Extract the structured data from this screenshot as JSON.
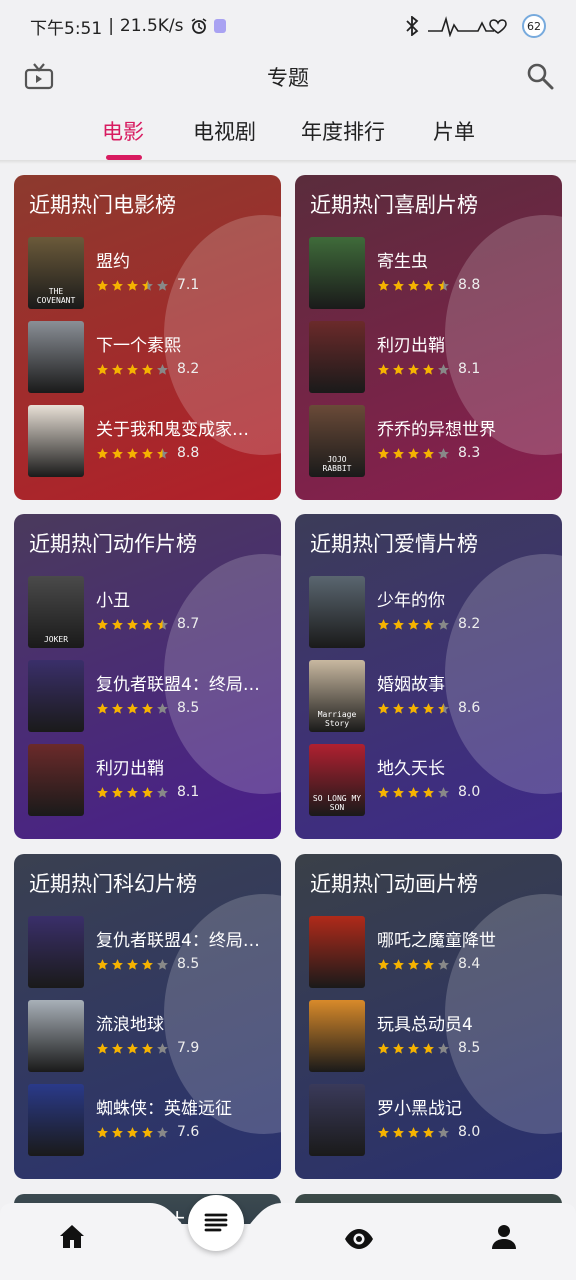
{
  "status_bar": {
    "time": "下午5:51",
    "network_speed": "21.5K/s",
    "battery": "62"
  },
  "header": {
    "title": "专题"
  },
  "tabs": [
    {
      "label": "电影",
      "active": true
    },
    {
      "label": "电视剧",
      "active": false
    },
    {
      "label": "年度排行",
      "active": false
    },
    {
      "label": "片单",
      "active": false
    }
  ],
  "cards": [
    {
      "title": "近期热门电影榜",
      "color_top": "#8c3a2e",
      "color_bottom": "#b2202a",
      "movies": [
        {
          "name": "盟约",
          "score": "7.1",
          "stars": 3.5,
          "poster_text": "THE COVENANT",
          "poster_color": "#6b5a3a"
        },
        {
          "name": "下一个素熙",
          "score": "8.2",
          "stars": 4,
          "poster_text": "",
          "poster_color": "#8a8f96"
        },
        {
          "name": "关于我和鬼变成家…",
          "score": "8.8",
          "stars": 4.5,
          "poster_text": "",
          "poster_color": "#e8e0d6"
        }
      ]
    },
    {
      "title": "近期热门喜剧片榜",
      "color_top": "#5a2c3c",
      "color_bottom": "#8a1f4f",
      "movies": [
        {
          "name": "寄生虫",
          "score": "8.8",
          "stars": 4.5,
          "poster_text": "",
          "poster_color": "#3f6b3a"
        },
        {
          "name": "利刃出鞘",
          "score": "8.1",
          "stars": 4,
          "poster_text": "",
          "poster_color": "#6b2a2a"
        },
        {
          "name": "乔乔的异想世界",
          "score": "8.3",
          "stars": 4,
          "poster_text": "JOJO RABBIT",
          "poster_color": "#6a4a38"
        }
      ]
    },
    {
      "title": "近期热门动作片榜",
      "color_top": "#4a3a5c",
      "color_bottom": "#4a1f8c",
      "movies": [
        {
          "name": "小丑",
          "score": "8.7",
          "stars": 4.5,
          "poster_text": "JOKER",
          "poster_color": "#4a4a4a"
        },
        {
          "name": "复仇者联盟4：终局…",
          "score": "8.5",
          "stars": 4,
          "poster_text": "",
          "poster_color": "#3a2f6a"
        },
        {
          "name": "利刃出鞘",
          "score": "8.1",
          "stars": 4,
          "poster_text": "",
          "poster_color": "#6b2a2a"
        }
      ]
    },
    {
      "title": "近期热门爱情片榜",
      "color_top": "#3c3c58",
      "color_bottom": "#3f2a8a",
      "movies": [
        {
          "name": "少年的你",
          "score": "8.2",
          "stars": 4,
          "poster_text": "",
          "poster_color": "#5a6670"
        },
        {
          "name": "婚姻故事",
          "score": "8.6",
          "stars": 4.5,
          "poster_text": "Marriage Story",
          "poster_color": "#c8b8a0"
        },
        {
          "name": "地久天长",
          "score": "8.0",
          "stars": 4,
          "poster_text": "SO LONG MY SON",
          "poster_color": "#b02030"
        }
      ]
    },
    {
      "title": "近期热门科幻片榜",
      "color_top": "#3a4050",
      "color_bottom": "#2a3270",
      "movies": [
        {
          "name": "复仇者联盟4：终局…",
          "score": "8.5",
          "stars": 4,
          "poster_text": "",
          "poster_color": "#3a2f6a"
        },
        {
          "name": "流浪地球",
          "score": "7.9",
          "stars": 4,
          "poster_text": "",
          "poster_color": "#a8b0b8"
        },
        {
          "name": "蜘蛛侠：英雄远征",
          "score": "7.6",
          "stars": 4,
          "poster_text": "",
          "poster_color": "#2a3a8a"
        }
      ]
    },
    {
      "title": "近期热门动画片榜",
      "color_top": "#3a4048",
      "color_bottom": "#2a3070",
      "movies": [
        {
          "name": "哪吒之魔童降世",
          "score": "8.4",
          "stars": 4,
          "poster_text": "",
          "poster_color": "#b02a1a"
        },
        {
          "name": "玩具总动员4",
          "score": "8.5",
          "stars": 4,
          "poster_text": "",
          "poster_color": "#d88a2a"
        },
        {
          "name": "罗小黑战记",
          "score": "8.0",
          "stars": 4,
          "poster_text": "",
          "poster_color": "#3a3a5a"
        }
      ]
    }
  ],
  "partial_card_title": "疑片",
  "colors": {
    "accent": "#d81b60",
    "star": "#f5b301",
    "star_empty": "#888888"
  },
  "bottom_nav": {
    "items": [
      "home-icon",
      "list-icon",
      "eye-icon",
      "profile-icon"
    ]
  }
}
